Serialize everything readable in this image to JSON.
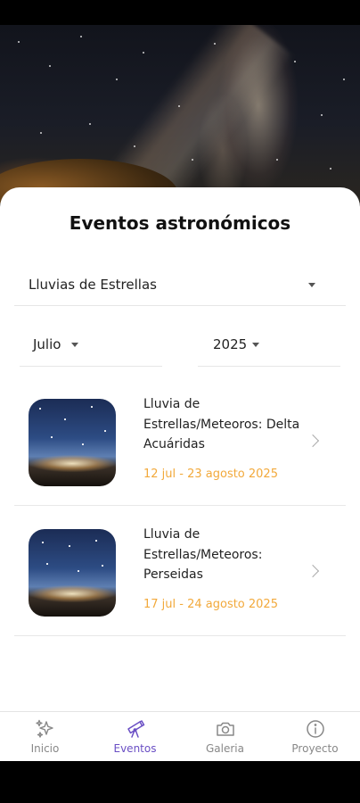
{
  "page_title": "Eventos astronómicos",
  "category_select": {
    "value": "Lluvias de Estrellas"
  },
  "month_select": {
    "value": "Julio"
  },
  "year_select": {
    "value": "2025"
  },
  "events": [
    {
      "title": "Lluvia de Estrellas/Meteoros: Delta Acuáridas",
      "dates": "12 jul - 23 agosto 2025"
    },
    {
      "title": "Lluvia de Estrellas/Meteoros: Perseidas",
      "dates": "17 jul - 24 agosto 2025"
    }
  ],
  "bottom_nav": [
    {
      "label": "Inicio",
      "icon": "sparkles-icon"
    },
    {
      "label": "Eventos",
      "icon": "telescope-icon",
      "active": true
    },
    {
      "label": "Galeria",
      "icon": "camera-icon"
    },
    {
      "label": "Proyecto",
      "icon": "info-icon"
    }
  ],
  "colors": {
    "accent": "#6a4fc4",
    "date": "#f2a93b"
  }
}
